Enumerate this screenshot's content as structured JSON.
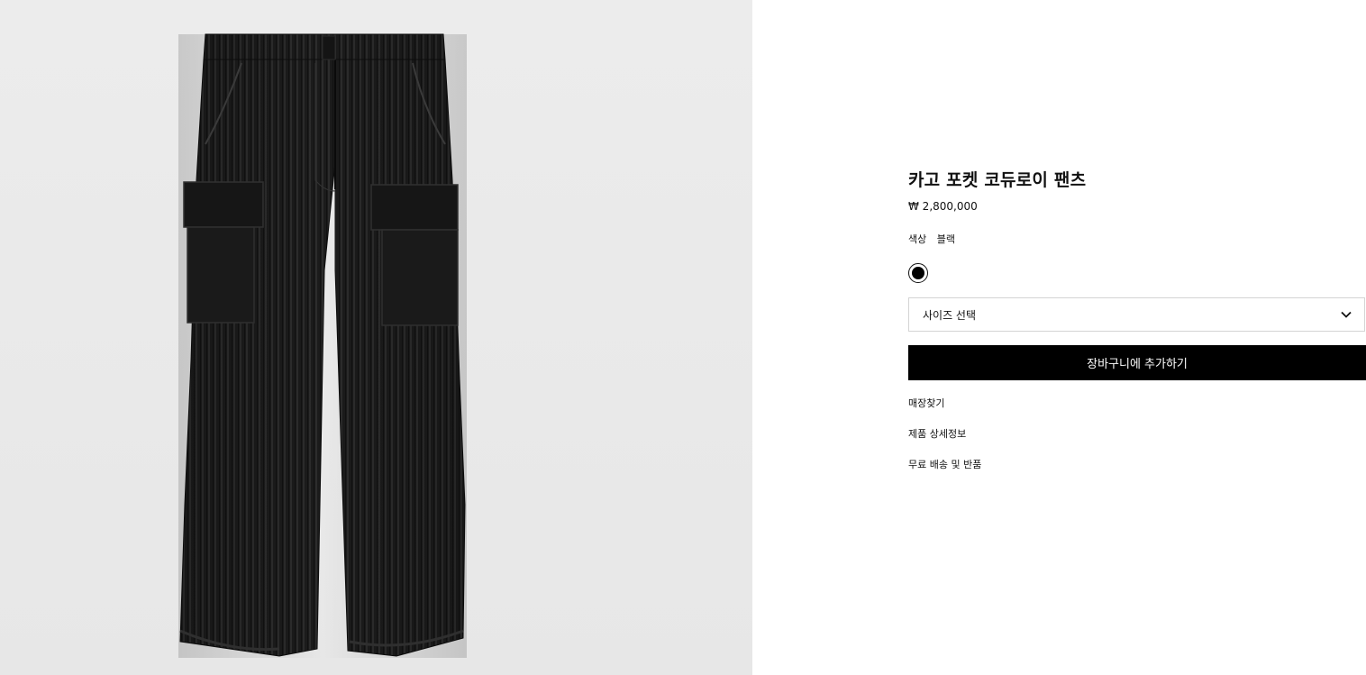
{
  "product": {
    "title": "카고 포켓 코듀로이 팬츠",
    "price": "₩ 2,800,000",
    "image_icon": "cargo-pants-image"
  },
  "color": {
    "label": "색상",
    "value": "블랙",
    "swatches": [
      {
        "name": "블랙",
        "hex": "#000000",
        "selected": true
      }
    ]
  },
  "size_select": {
    "placeholder": "사이즈 선택",
    "icon": "chevron-down-icon"
  },
  "add_to_cart": {
    "label": "장바구니에 추가하기"
  },
  "links": [
    {
      "label": "매장찾기"
    },
    {
      "label": "제품 상세정보"
    },
    {
      "label": "무료 배송 및 반품"
    }
  ],
  "colors": {
    "button_bg": "#000000",
    "button_text": "#ffffff",
    "gallery_bg": "#e9e9e9",
    "select_border": "#d4d4d4"
  }
}
